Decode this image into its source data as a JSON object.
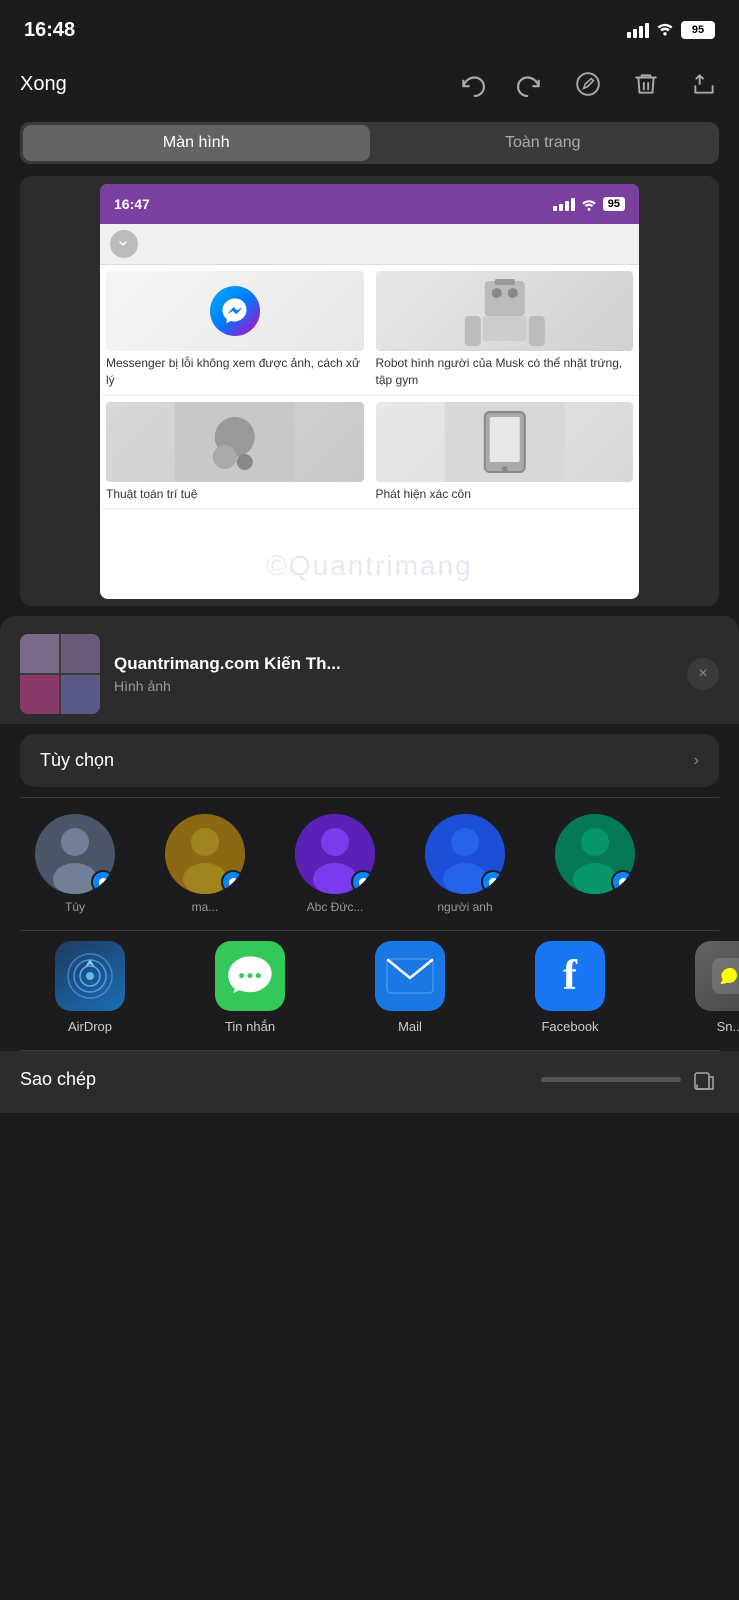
{
  "statusBar": {
    "time": "16:48",
    "battery": "95"
  },
  "toolbar": {
    "done_label": "Xong",
    "icons": [
      "undo",
      "redo",
      "markup",
      "trash",
      "share"
    ]
  },
  "segmentControl": {
    "option1": "Màn hình",
    "option2": "Toàn trang",
    "active": 0
  },
  "browserPreview": {
    "time": "16:47",
    "battery": "95",
    "articles": [
      {
        "title": "Messenger bị lỗi không xem được ảnh, cách xử lý",
        "type": "messenger"
      },
      {
        "title": "Robot hình người của Musk có thể nhặt trứng, tập gym",
        "type": "robot"
      },
      {
        "title": "Thuật toán trí tuệ",
        "type": "brain"
      },
      {
        "title": "Phát hiện xác côn",
        "type": "device"
      }
    ]
  },
  "shareSheet": {
    "title": "Quantrimang.com Kiến Th...",
    "subtitle": "Hình ảnh",
    "close_label": "×",
    "options_label": "Tùy chọn",
    "options_chevron": "›",
    "watermark": "©Quantrimang"
  },
  "contacts": [
    {
      "name": "Tùy",
      "color": "av1"
    },
    {
      "name": "ma...",
      "color": "av2"
    },
    {
      "name": "Abc Đức...",
      "color": "av3"
    },
    {
      "name": "người anh",
      "color": "av4"
    },
    {
      "name": "",
      "color": "av5"
    }
  ],
  "apps": [
    {
      "name": "AirDrop",
      "type": "airdrop"
    },
    {
      "name": "Tin nhắn",
      "type": "messages"
    },
    {
      "name": "Mail",
      "type": "mail"
    },
    {
      "name": "Facebook",
      "type": "facebook"
    },
    {
      "name": "Sn...",
      "type": "more"
    }
  ],
  "bottomBar": {
    "label": "Sao chép"
  }
}
